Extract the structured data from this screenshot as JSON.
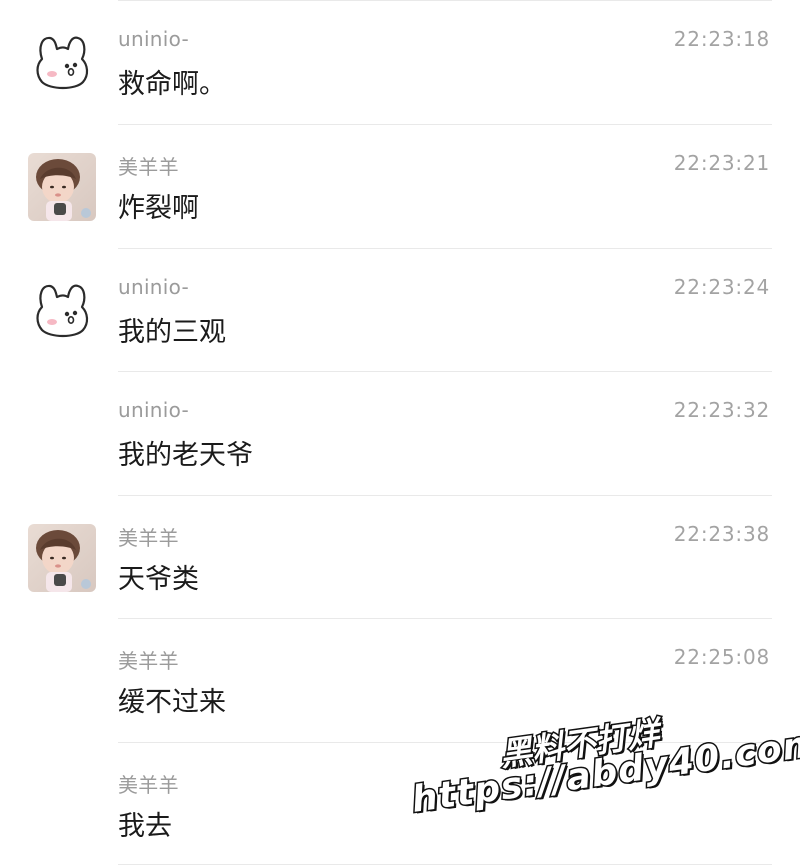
{
  "messages": [
    {
      "sender": "uninio-",
      "time": "22:23:18",
      "text": "救命啊。",
      "avatar": "bunny-avatar-icon"
    },
    {
      "sender": "美羊羊",
      "time": "22:23:21",
      "text": "炸裂啊",
      "avatar": "girl-photo-avatar"
    },
    {
      "sender": "uninio-",
      "time": "22:23:24",
      "text": "我的三观",
      "avatar": "bunny-avatar-icon"
    },
    {
      "sender": "uninio-",
      "time": "22:23:32",
      "text": "我的老天爷",
      "avatar": null
    },
    {
      "sender": "美羊羊",
      "time": "22:23:38",
      "text": "天爷类",
      "avatar": "girl-photo-avatar"
    },
    {
      "sender": "美羊羊",
      "time": "22:25:08",
      "text": "缓不过来",
      "avatar": null
    },
    {
      "sender": "美羊羊",
      "time": "",
      "text": "我去",
      "avatar": null
    }
  ],
  "watermark": {
    "line1": "黑料不打烊",
    "line2": "https://abdy40.com"
  },
  "colors": {
    "name": "#9b9b9b",
    "time": "#a3a3a3",
    "text": "#1b1b1b",
    "separator": "#e9e9e9"
  }
}
